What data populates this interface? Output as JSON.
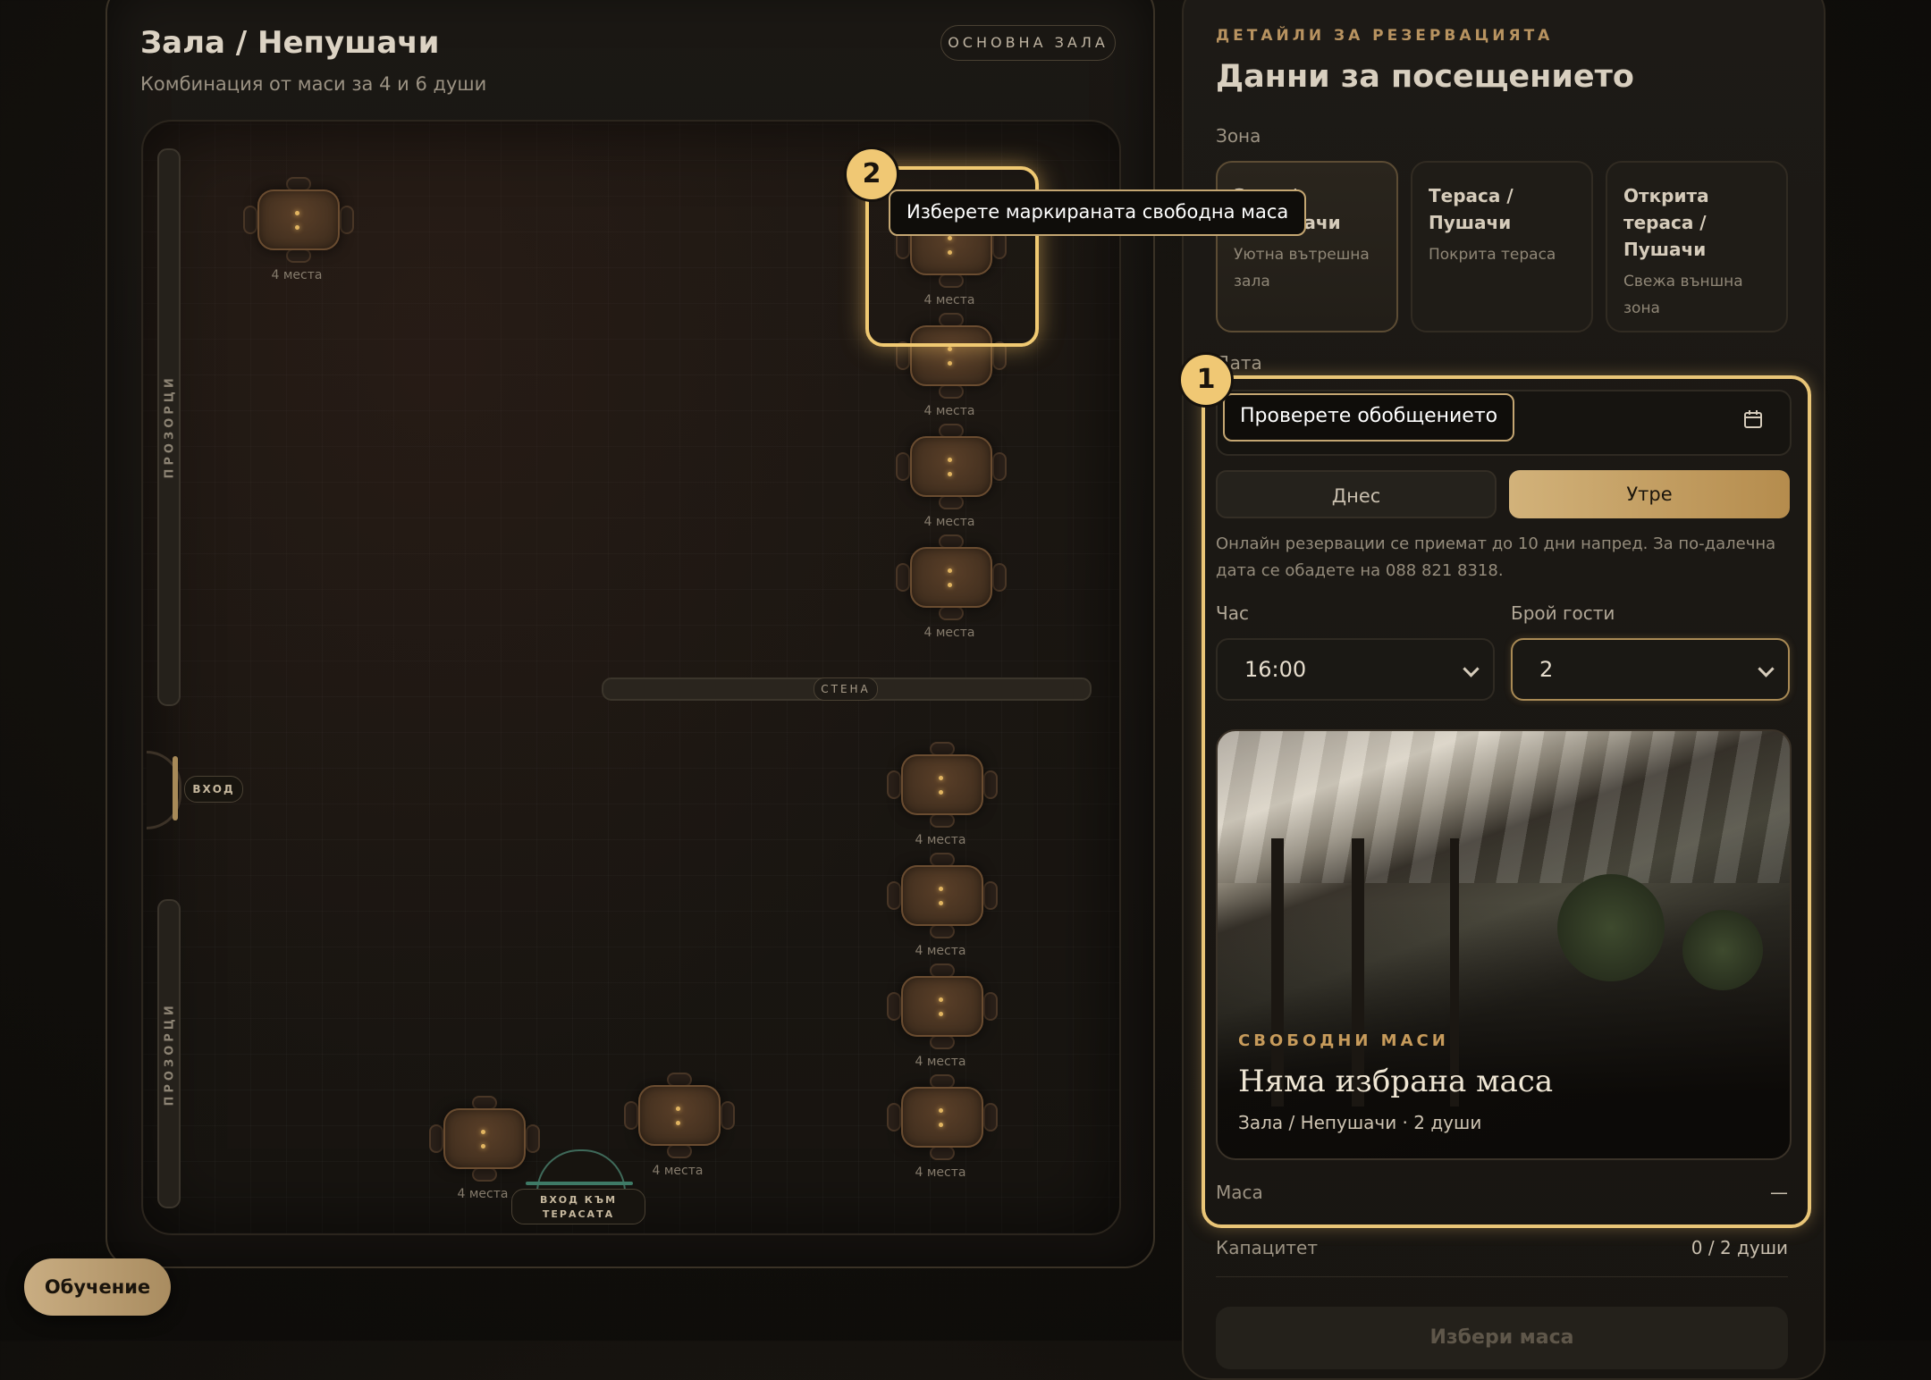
{
  "plan": {
    "title": "Зала / Непушачи",
    "subtitle": "Комбинация от маси за 4 и 6 души",
    "zone_pill": "ОСНОВНА ЗАЛА",
    "windows_label": "ПРОЗОРЦИ",
    "wall_label": "СТЕНА",
    "entrance_label": "ВХОД",
    "terrace_entrance_line1": "ВХОД КЪМ",
    "terrace_entrance_line2": "ТЕРАСАТА",
    "table_caption": "4 места"
  },
  "tour": {
    "step1_number": "1",
    "step1_text": "Проверете обобщението",
    "step2_number": "2",
    "step2_text": "Изберете маркираната свободна маса"
  },
  "details": {
    "eyebrow": "ДЕТАЙЛИ ЗА РЕЗЕРВАЦИЯТА",
    "title": "Данни за посещението",
    "zone_label": "Зона",
    "zones": [
      {
        "title": "Зала / Непушачи",
        "desc": "Уютна вътрешна зала",
        "selected": true
      },
      {
        "title": "Тераса / Пушачи",
        "desc": "Покрита тераса",
        "selected": false
      },
      {
        "title": "Открита тераса / Пушачи",
        "desc": "Свежа външна зона",
        "selected": false
      }
    ],
    "date_label": "Дата",
    "today": "Днес",
    "tomorrow": "Утре",
    "notice": "Онлайн резервации се приемат до 10 дни напред. За по-далечна дата се обадете на 088 821 8318.",
    "time_label": "Час",
    "time_value": "16:00",
    "guests_label": "Брой гости",
    "guests_value": "2",
    "photo_eyebrow": "СВОБОДНИ МАСИ",
    "photo_title": "Няма избрана маса",
    "photo_sub": "Зала / Непушачи · 2 души",
    "table_label": "Маса",
    "table_value": "—",
    "capacity_label": "Капацитет",
    "capacity_value": "0 / 2 души",
    "choose_button": "Избери маса"
  },
  "tutorial_button": "Обучение",
  "colors": {
    "accent": "#f0c874",
    "gold": "#b58c4d",
    "panel": "#1d1a16"
  }
}
